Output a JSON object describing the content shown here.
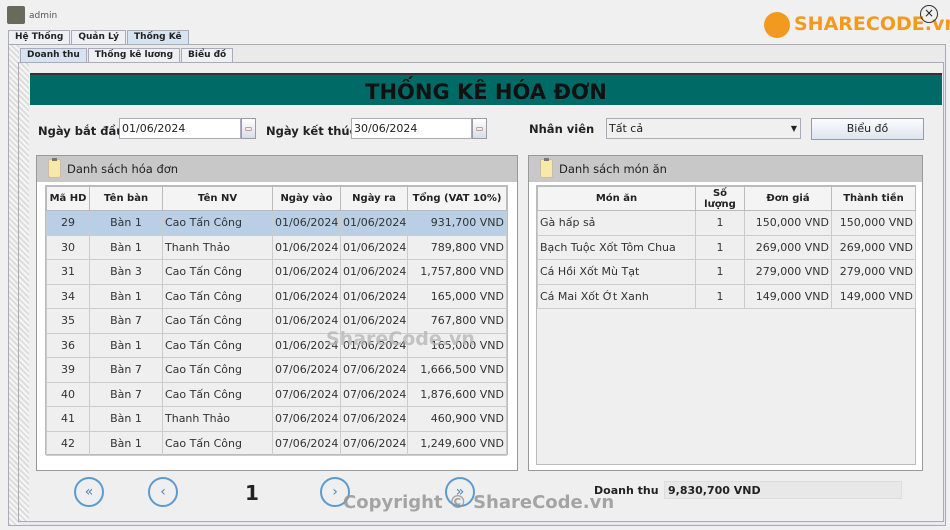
{
  "app": {
    "user": "admin",
    "close_icon": "close-icon",
    "logo": "SHARECODE.vn"
  },
  "main_tabs": [
    {
      "label": "Hệ Thống"
    },
    {
      "label": "Quản Lý"
    },
    {
      "label": "Thống Kê",
      "selected": true
    }
  ],
  "sub_tabs": [
    {
      "label": "Doanh thu",
      "selected": true
    },
    {
      "label": "Thống kê lương"
    },
    {
      "label": "Biểu đồ"
    }
  ],
  "title": "THỐNG KÊ HÓA ĐƠN",
  "filters": {
    "start_label": "Ngày bắt đầu",
    "start_value": "01/06/2024",
    "end_label": "Ngày kết thúc",
    "end_value": "30/06/2024",
    "staff_label": "Nhân viên",
    "staff_value": "Tất cả",
    "chart_button": "Biểu đồ"
  },
  "invoices": {
    "title": "Danh sách hóa đơn",
    "columns": [
      "Mã HD",
      "Tên bàn",
      "Tên NV",
      "Ngày vào",
      "Ngày ra",
      "Tổng (VAT 10%)"
    ],
    "rows": [
      [
        "29",
        "Bàn 1",
        "Cao Tấn Công",
        "01/06/2024",
        "01/06/2024",
        "931,700 VND"
      ],
      [
        "30",
        "Bàn 1",
        "Thanh Thảo",
        "01/06/2024",
        "01/06/2024",
        "789,800 VND"
      ],
      [
        "31",
        "Bàn 3",
        "Cao Tấn Công",
        "01/06/2024",
        "01/06/2024",
        "1,757,800 VND"
      ],
      [
        "34",
        "Bàn 1",
        "Cao Tấn Công",
        "01/06/2024",
        "01/06/2024",
        "165,000 VND"
      ],
      [
        "35",
        "Bàn 7",
        "Cao Tấn Công",
        "01/06/2024",
        "01/06/2024",
        "767,800 VND"
      ],
      [
        "36",
        "Bàn 1",
        "Cao Tấn Công",
        "01/06/2024",
        "01/06/2024",
        "165,000 VND"
      ],
      [
        "39",
        "Bàn 7",
        "Cao Tấn Công",
        "07/06/2024",
        "07/06/2024",
        "1,666,500 VND"
      ],
      [
        "40",
        "Bàn 7",
        "Cao Tấn Công",
        "07/06/2024",
        "07/06/2024",
        "1,876,600 VND"
      ],
      [
        "41",
        "Bàn 1",
        "Thanh Thảo",
        "07/06/2024",
        "07/06/2024",
        "460,900 VND"
      ],
      [
        "42",
        "Bàn 1",
        "Cao Tấn Công",
        "07/06/2024",
        "07/06/2024",
        "1,249,600 VND"
      ]
    ]
  },
  "dishes": {
    "title": "Danh sách món ăn",
    "columns": [
      "Món ăn",
      "Số lượng",
      "Đơn giá",
      "Thành tiền"
    ],
    "rows": [
      [
        "Gà hấp sả",
        "1",
        "150,000 VND",
        "150,000 VND"
      ],
      [
        "Bạch Tuộc Xốt Tôm Chua",
        "1",
        "269,000 VND",
        "269,000 VND"
      ],
      [
        "Cá Hồi Xốt Mù Tạt",
        "1",
        "279,000 VND",
        "279,000 VND"
      ],
      [
        "Cá Mai Xốt Ớt Xanh",
        "1",
        "149,000 VND",
        "149,000 VND"
      ]
    ]
  },
  "pagination": {
    "first": "«",
    "prev": "‹",
    "page": "1",
    "next": "›",
    "last": "»"
  },
  "revenue": {
    "label": "Doanh thu",
    "value": "9,830,700 VND"
  },
  "watermark": {
    "center": "ShareCode.vn",
    "bottom": "Copyright © ShareCode.vn"
  }
}
